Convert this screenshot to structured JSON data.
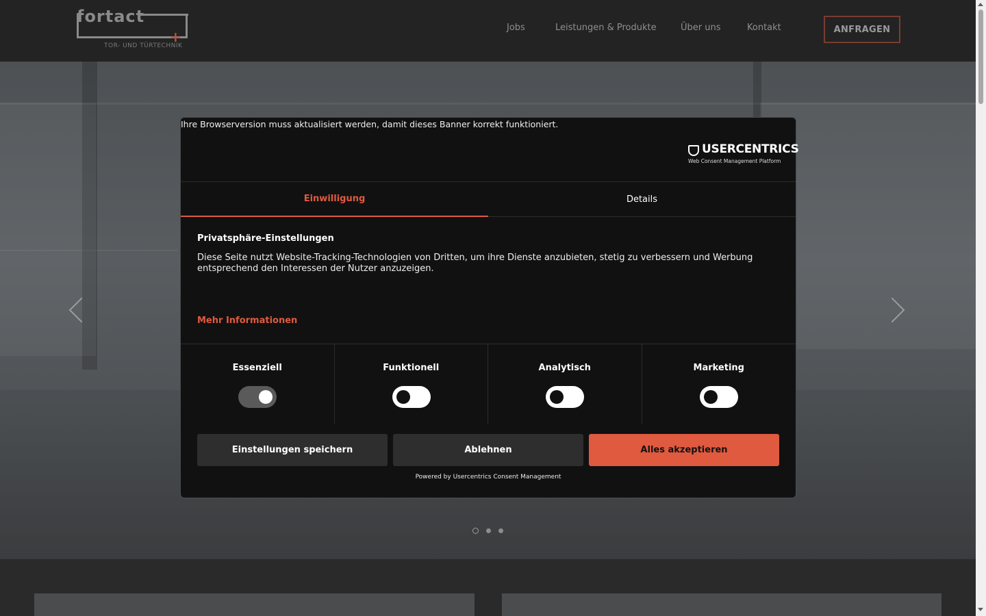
{
  "header": {
    "logo_word": "fortact",
    "logo_sub": "TOR- UND TÜRTECHNIK",
    "nav": [
      "Jobs",
      "Leistungen & Produkte",
      "Über uns",
      "Kontakt"
    ],
    "cta": "ANFRAGEN"
  },
  "slider": {
    "slide_count": 3,
    "active_slide": 1
  },
  "consent": {
    "warning": "Ihre Browserversion muss aktualisiert werden, damit dieses Banner korrekt funktioniert.",
    "brand": "USERCENTRICS",
    "brand_tagline": "Web Consent Management Platform",
    "tabs": [
      "Einwilligung",
      "Details"
    ],
    "active_tab": "Einwilligung",
    "title": "Privatsphäre-Einstellungen",
    "text": "Diese Seite nutzt Website-Tracking-Technologien von Dritten, um ihre Dienste anzubieten, stetig zu verbessern und Werbung entsprechend den Interessen der Nutzer anzuzeigen.",
    "more_info": "Mehr Informationen",
    "categories": [
      {
        "label": "Essenziell",
        "enabled": true,
        "locked": true
      },
      {
        "label": "Funktionell",
        "enabled": false,
        "locked": false
      },
      {
        "label": "Analytisch",
        "enabled": false,
        "locked": false
      },
      {
        "label": "Marketing",
        "enabled": false,
        "locked": false
      }
    ],
    "buttons": {
      "save": "Einstellungen speichern",
      "deny": "Ablehnen",
      "accept": "Alles akzeptieren"
    },
    "powered_by": "Powered by Usercentrics Consent Management"
  },
  "colors": {
    "accent": "#e05a40",
    "header_bg": "#232323",
    "modal_bg": "#111111"
  }
}
